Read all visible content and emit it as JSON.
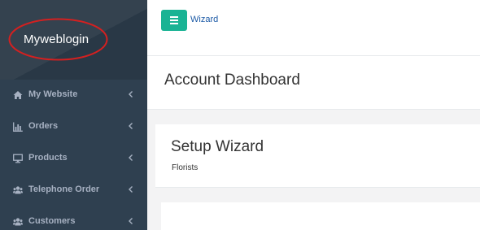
{
  "sidebar": {
    "logo": "Myweblogin",
    "items": [
      {
        "label": "My Website",
        "icon": "home-icon"
      },
      {
        "label": "Orders",
        "icon": "bar-chart-icon"
      },
      {
        "label": "Products",
        "icon": "desktop-icon"
      },
      {
        "label": "Telephone Order",
        "icon": "users-icon"
      },
      {
        "label": "Customers",
        "icon": "users-icon"
      }
    ]
  },
  "topbar": {
    "menu_icon": "hamburger-icon",
    "breadcrumb": "Wizard"
  },
  "page": {
    "title": "Account Dashboard"
  },
  "setup_card": {
    "title": "Setup Wizard",
    "subtitle": "Florists"
  },
  "colors": {
    "sidebar_bg": "#2f4050",
    "accent": "#1ab394",
    "highlight_circle": "#d42020"
  }
}
